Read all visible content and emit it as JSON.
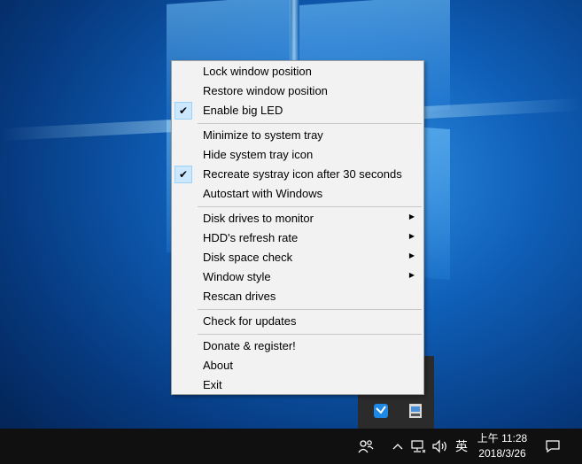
{
  "menu": {
    "items": [
      {
        "label": "Lock window position",
        "checked": false,
        "submenu": false
      },
      {
        "label": "Restore window position",
        "checked": false,
        "submenu": false
      },
      {
        "label": "Enable big LED",
        "checked": true,
        "submenu": false
      },
      {
        "label": "Minimize to system tray",
        "checked": false,
        "submenu": false
      },
      {
        "label": "Hide system tray icon",
        "checked": false,
        "submenu": false
      },
      {
        "label": "Recreate systray icon after 30 seconds",
        "checked": true,
        "submenu": false
      },
      {
        "label": "Autostart with Windows",
        "checked": false,
        "submenu": false
      },
      {
        "label": "Disk drives to monitor",
        "checked": false,
        "submenu": true
      },
      {
        "label": "HDD's refresh rate",
        "checked": false,
        "submenu": true
      },
      {
        "label": "Disk space check",
        "checked": false,
        "submenu": true
      },
      {
        "label": "Window style",
        "checked": false,
        "submenu": true
      },
      {
        "label": "Rescan drives",
        "checked": false,
        "submenu": false
      },
      {
        "label": "Check for updates",
        "checked": false,
        "submenu": false
      },
      {
        "label": "Donate & register!",
        "checked": false,
        "submenu": false
      },
      {
        "label": "About",
        "checked": false,
        "submenu": false
      },
      {
        "label": "Exit",
        "checked": false,
        "submenu": false
      }
    ],
    "check_glyph": "✔",
    "submenu_glyph": "▶"
  },
  "taskbar": {
    "input_method": "英",
    "clock_period": "上午 11:28",
    "clock_date": "2018/3/26",
    "icons": [
      "people-icon",
      "show-hidden-icons-chevron",
      "network-icon",
      "volume-icon",
      "input-method-indicator",
      "action-center-icon"
    ]
  },
  "tray_flyout": {
    "icons": [
      "app-tray-icon",
      "hdd-led-tray-icon"
    ]
  },
  "colors": {
    "menu_bg": "#f2f2f2",
    "check_highlight": "#cce8ff",
    "taskbar_bg": "#101010",
    "flyout_bg": "#2b2b2b",
    "desktop_blue": "#0f5fb8"
  }
}
